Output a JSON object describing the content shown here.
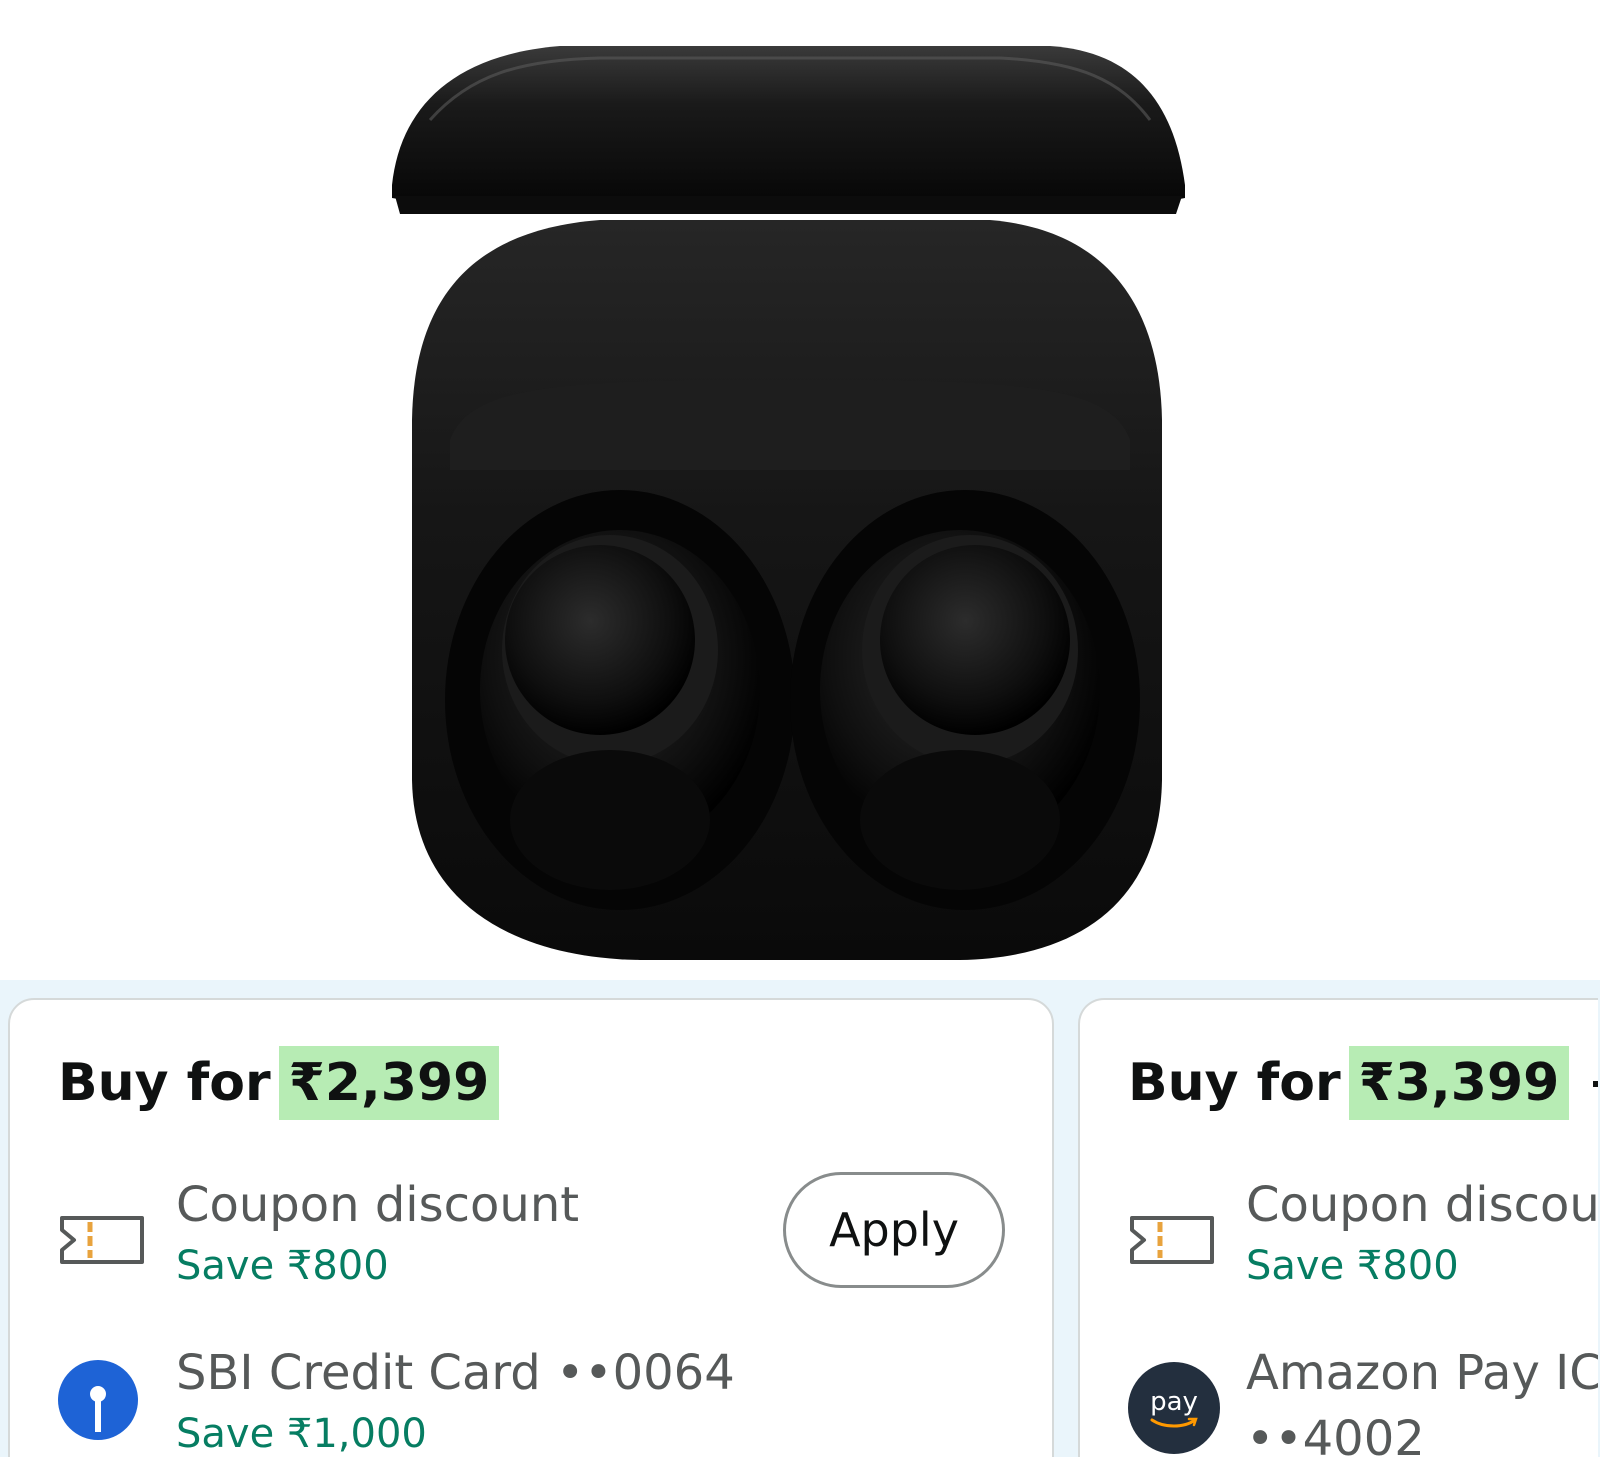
{
  "product": {
    "image_alt": "Black wireless earbuds in open charging case",
    "image_icon": "earbuds-case-image"
  },
  "offers": [
    {
      "buy_prefix": "Buy for",
      "price": "₹2,399",
      "coupon_title": "Coupon discount",
      "coupon_save": "Save ₹800",
      "apply_label": "Apply",
      "payment_title": "SBI Credit Card ••0064",
      "payment_save": "Save ₹1,000",
      "payment_icon": "sbi-logo-icon"
    },
    {
      "buy_prefix": "Buy for",
      "price": "₹3,399",
      "price_suffix": "+",
      "coupon_title": "Coupon discou",
      "coupon_save": "Save ₹800",
      "payment_title": "Amazon Pay IC",
      "payment_subtitle": "••4002",
      "payment_logo_text": "pay",
      "payment_icon": "amazon-pay-logo-icon"
    }
  ],
  "colors": {
    "price_highlight": "#b7ecb4",
    "save_text": "#067d62",
    "strip_background": "#eaf5fb",
    "sbi_blue": "#1e63d6",
    "amazon_pay_dark": "#232f3e",
    "coupon_accent": "#e8a33d"
  }
}
